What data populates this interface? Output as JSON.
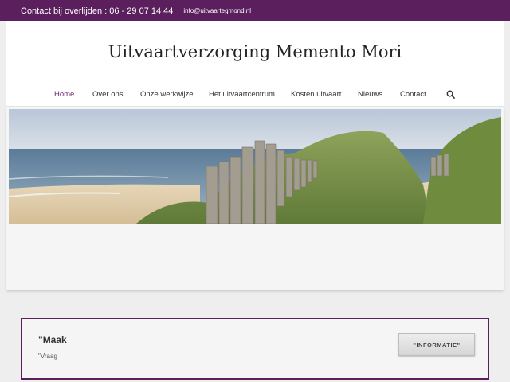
{
  "topbar": {
    "phone": "Contact bij overlijden : 06 - 29 07 14 44",
    "email": "info@uitvaartegmond.nl"
  },
  "header": {
    "site_title": "Uitvaartverzorging Memento Mori"
  },
  "nav": {
    "items": [
      {
        "label": "Home",
        "active": true
      },
      {
        "label": "Over ons"
      },
      {
        "label": "Onze werkwijze"
      },
      {
        "label": "Het uitvaartcentrum"
      },
      {
        "label": "Kosten uitvaart"
      },
      {
        "label": "Nieuws"
      },
      {
        "label": "Contact"
      }
    ],
    "search_icon": "search-icon"
  },
  "hero": {
    "image": "beach-dunes-fence-photo"
  },
  "callout": {
    "title": "\"Maak",
    "subtitle": "\"Vraag",
    "button": "\"INFORMATIE\""
  },
  "colors": {
    "brand_purple": "#5b1f5e",
    "active_link": "#6b2c6e"
  }
}
